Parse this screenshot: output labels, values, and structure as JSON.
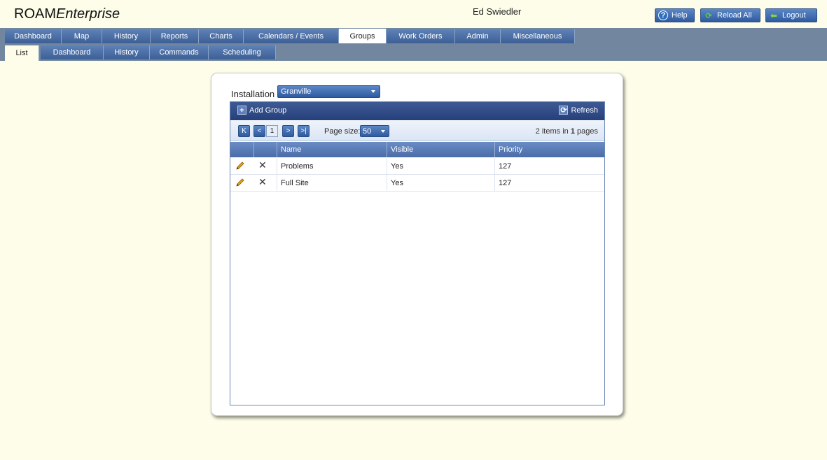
{
  "header": {
    "logo_main": "ROAM",
    "logo_italic": "Enterprise",
    "user_name": "Ed Swiedler",
    "buttons": {
      "help": "Help",
      "reload": "Reload All",
      "logout": "Logout"
    }
  },
  "nav": {
    "main_tabs": [
      "Dashboard",
      "Map",
      "History",
      "Reports",
      "Charts",
      "Calendars / Events",
      "Groups",
      "Work Orders",
      "Admin",
      "Miscellaneous"
    ],
    "active_main": "Groups",
    "sub_tabs": [
      "List",
      "Dashboard",
      "History",
      "Commands",
      "Scheduling"
    ],
    "active_sub": "List"
  },
  "installation": {
    "label": "Installation",
    "value": "Granville"
  },
  "grid": {
    "add_label": "Add Group",
    "refresh_label": "Refresh",
    "pager": {
      "current_page": "1",
      "page_size_label": "Page size:",
      "page_size": "50",
      "items_text": "2 items in",
      "pages_count": "1",
      "pages_word": "pages"
    },
    "columns": [
      "Name",
      "Visible",
      "Priority"
    ],
    "rows": [
      {
        "name": "Problems",
        "visible": "Yes",
        "priority": "127"
      },
      {
        "name": "Full Site",
        "visible": "Yes",
        "priority": "127"
      }
    ]
  },
  "colors": {
    "nav_bg": "#72879f",
    "tab_blue": "#3d5f95",
    "page_bg": "#fdfde9"
  },
  "icons": {
    "help": "help-icon",
    "reload": "reload-icon",
    "logout": "logout-icon",
    "add": "plus-icon",
    "refresh": "refresh-icon",
    "edit": "pencil-icon",
    "delete": "delete-icon"
  }
}
